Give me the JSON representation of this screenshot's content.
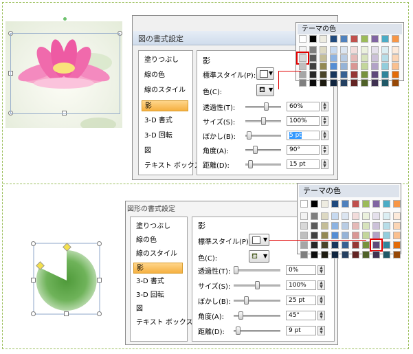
{
  "dialog_top": {
    "title": "図の書式設定",
    "nav": [
      "塗りつぶし",
      "線の色",
      "線のスタイル",
      "影",
      "3-D 書式",
      "3-D 回転",
      "図",
      "テキスト ボックス"
    ],
    "selected_nav_index": 3,
    "section_title": "影",
    "preset_label": "標準スタイル(P):",
    "color_label": "色(C):",
    "rows": [
      {
        "label": "透過性(T):",
        "value": "60%",
        "level": 0.6
      },
      {
        "label": "サイズ(S):",
        "value": "100%",
        "level": 0.5
      },
      {
        "label": "ぼかし(B):",
        "value": "5 pt",
        "level": 0.05
      },
      {
        "label": "角度(A):",
        "value": "90°",
        "level": 0.25
      },
      {
        "label": "距離(D):",
        "value": "15 pt",
        "level": 0.08
      }
    ],
    "highlighted_row": 2
  },
  "dialog_bottom": {
    "title": "図形の書式設定",
    "nav": [
      "塗りつぶし",
      "線の色",
      "線のスタイル",
      "影",
      "3-D 書式",
      "3-D 回転",
      "図",
      "テキスト ボックス"
    ],
    "selected_nav_index": 3,
    "section_title": "影",
    "preset_label": "標準スタイル(P):",
    "color_label": "色(C):",
    "rows": [
      {
        "label": "透過性(T):",
        "value": "0%",
        "level": 0.0
      },
      {
        "label": "サイズ(S):",
        "value": "100%",
        "level": 0.5
      },
      {
        "label": "ぼかし(B):",
        "value": "25 pt",
        "level": 0.25
      },
      {
        "label": "角度(A):",
        "value": "45°",
        "level": 0.12
      },
      {
        "label": "距離(D):",
        "value": "9 pt",
        "level": 0.05
      }
    ]
  },
  "palette_top": {
    "title": "テーマの色",
    "selected": {
      "row": 1,
      "col": 0
    }
  },
  "palette_bottom": {
    "title": "テーマの色",
    "selected": {
      "row": 3,
      "col": 7
    }
  },
  "theme_colors": {
    "top_row": [
      "#ffffff",
      "#000000",
      "#eeece1",
      "#1f497d",
      "#4f81bd",
      "#c0504d",
      "#9bbb59",
      "#8064a2",
      "#4bacc6",
      "#f79646"
    ],
    "shades": [
      [
        "#f2f2f2",
        "#7f7f7f",
        "#ddd9c3",
        "#c6d9f0",
        "#dbe5f1",
        "#f2dcdb",
        "#ebf1dd",
        "#e5e0ec",
        "#dbeef3",
        "#fdeada"
      ],
      [
        "#d8d8d8",
        "#595959",
        "#c4bd97",
        "#8db3e2",
        "#b8cce4",
        "#e5b9b7",
        "#d7e3bc",
        "#ccc1d9",
        "#b7dde8",
        "#fbd5b5"
      ],
      [
        "#bfbfbf",
        "#3f3f3f",
        "#938953",
        "#548dd4",
        "#95b3d7",
        "#d99694",
        "#c3d69b",
        "#b2a2c7",
        "#92cddc",
        "#fac08f"
      ],
      [
        "#a5a5a5",
        "#262626",
        "#494429",
        "#17365d",
        "#366092",
        "#953734",
        "#76923c",
        "#5f497a",
        "#31859b",
        "#e36c09"
      ],
      [
        "#7f7f7f",
        "#0c0c0c",
        "#1d1b10",
        "#0f243e",
        "#244061",
        "#632423",
        "#4f6128",
        "#3f3151",
        "#205867",
        "#974806"
      ]
    ]
  }
}
